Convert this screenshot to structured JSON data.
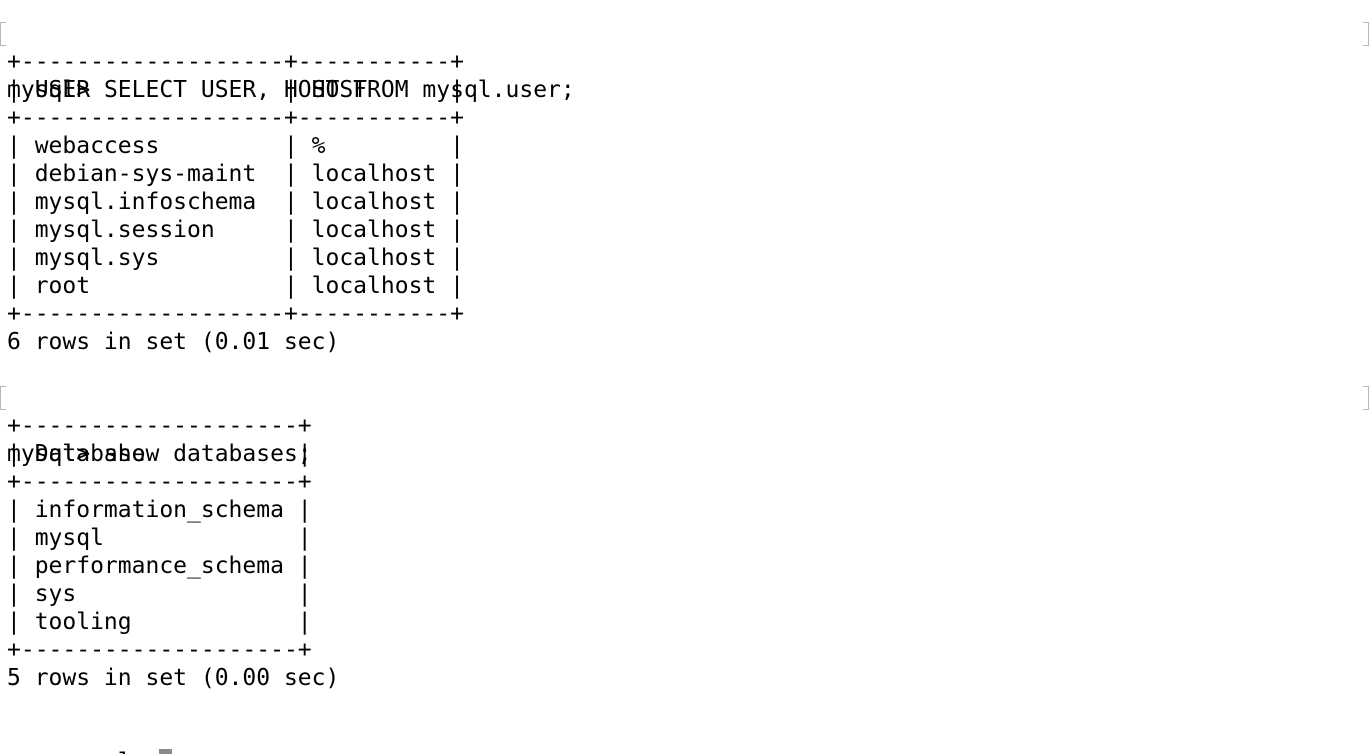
{
  "terminal": {
    "prompt": "mysql> ",
    "command1": "SELECT USER, HOST FROM mysql.user;",
    "table1": {
      "border": "+-------------------+-----------+",
      "header": "| USER              | HOST      |",
      "rows": [
        "| webaccess         | %         |",
        "| debian-sys-maint  | localhost |",
        "| mysql.infoschema  | localhost |",
        "| mysql.session     | localhost |",
        "| mysql.sys         | localhost |",
        "| root              | localhost |"
      ],
      "summary": "6 rows in set (0.01 sec)"
    },
    "command2": "show databases;",
    "table2": {
      "border": "+--------------------+",
      "header": "| Database           |",
      "rows": [
        "| information_schema |",
        "| mysql              |",
        "| performance_schema |",
        "| sys                |",
        "| tooling            |"
      ],
      "summary": "5 rows in set (0.00 sec)"
    },
    "cursor_color": "#8a8a8a",
    "marker_color": "#b7b7b7"
  }
}
